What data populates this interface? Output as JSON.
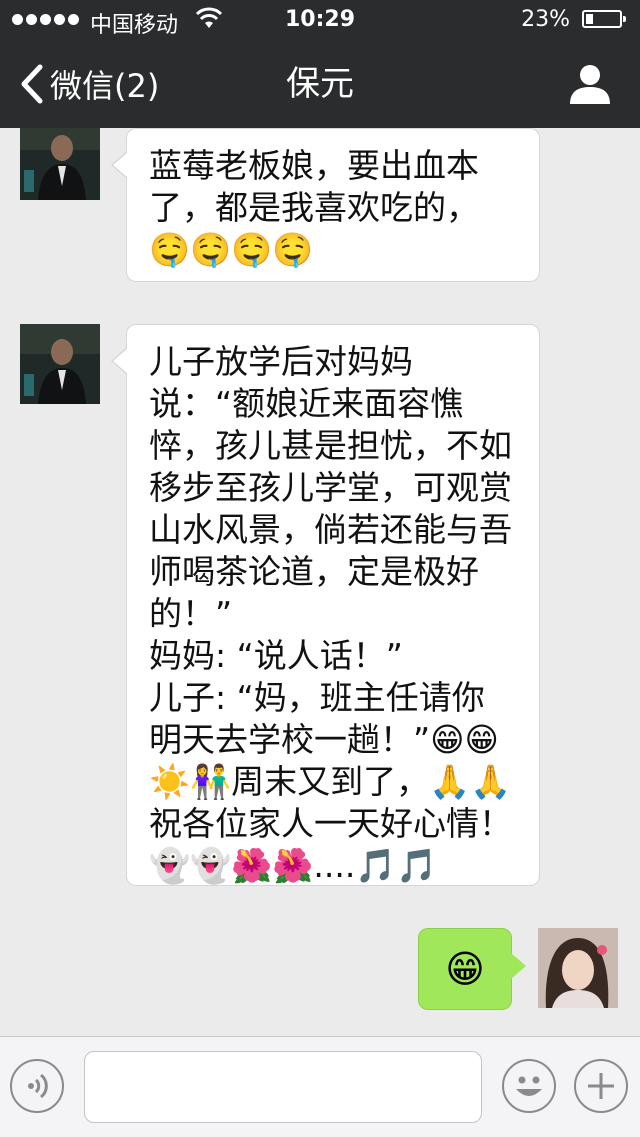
{
  "status_bar": {
    "carrier": "中国移动",
    "time": "10:29",
    "battery": "23%",
    "battery_level": 0.23
  },
  "nav": {
    "back_label": "微信(2)",
    "title": "保元",
    "back_icon": "chevron-left-icon",
    "profile_icon": "person-icon"
  },
  "messages": [
    {
      "side": "left",
      "text": "蓝莓老板娘，要出血本了，都是我喜欢吃的，🤤🤤🤤🤤"
    },
    {
      "side": "left",
      "text": "儿子放学后对妈妈说：“额娘近来面容憔悴，孩儿甚是担忧，不如移步至孩儿学堂，可观赏山水风景，倘若还能与吾师喝茶论道，定是极好的！”\n妈妈: “说人话！”\n儿子: “妈，班主任请你明天去学校一趟！”😁😁\n☀️👫周末又到了，🙏🙏\n祝各位家人一天好心情！\n👻👻🌺🌺....🎵🎵"
    },
    {
      "side": "right",
      "text": "😁"
    }
  ],
  "toolbar": {
    "voice_icon": "voice-icon",
    "emoji_icon": "smiley-icon",
    "plus_icon": "plus-icon",
    "input_value": ""
  },
  "colors": {
    "bar": "#2a2c2e",
    "chat_bg": "#ebebeb",
    "outgoing_bubble": "#a0e75a"
  }
}
